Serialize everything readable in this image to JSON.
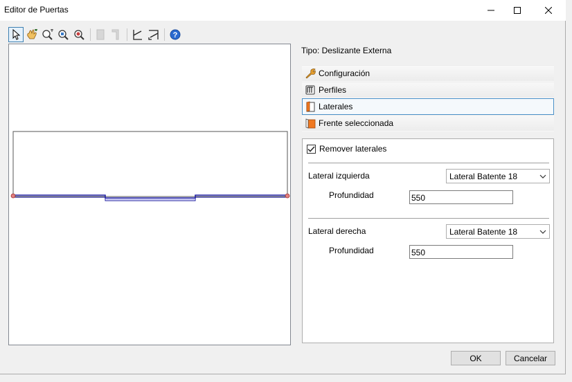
{
  "window": {
    "title": "Editor de Puertas"
  },
  "toolbar": {
    "buttons": [
      {
        "icon": "pointer-icon",
        "active": true
      },
      {
        "icon": "pan-hand-icon"
      },
      {
        "icon": "zoom-extents-icon"
      },
      {
        "icon": "zoom-window-icon"
      },
      {
        "icon": "zoom-icon"
      },
      {
        "icon": "view-front-icon",
        "disabled": true
      },
      {
        "icon": "view-side-icon",
        "disabled": true
      },
      {
        "icon": "view-left-icon"
      },
      {
        "icon": "view-right-icon"
      },
      {
        "icon": "help-icon"
      }
    ]
  },
  "tipo_label": "Tipo: Deslizante Externa",
  "tabs": [
    {
      "label": "Configuración",
      "icon": "wrench-icon",
      "selected": false
    },
    {
      "label": "Perfiles",
      "icon": "profiles-icon",
      "selected": false
    },
    {
      "label": "Laterales",
      "icon": "laterals-icon",
      "selected": true
    },
    {
      "label": "Frente seleccionada",
      "icon": "front-icon",
      "selected": false
    }
  ],
  "panel": {
    "remove_laterals_label": "Remover laterales",
    "remove_laterals_checked": true,
    "left": {
      "label": "Lateral izquierda",
      "selected": "Lateral Batente 18",
      "depth_label": "Profundidad",
      "depth_value": "550"
    },
    "right": {
      "label": "Lateral derecha",
      "selected": "Lateral Batente 18",
      "depth_label": "Profundidad",
      "depth_value": "550"
    }
  },
  "buttons": {
    "ok": "OK",
    "cancel": "Cancelar"
  },
  "colors": {
    "selection_border": "#4a90c8",
    "drawing_line": "#1a1aa0",
    "drawing_outline": "#555555"
  }
}
